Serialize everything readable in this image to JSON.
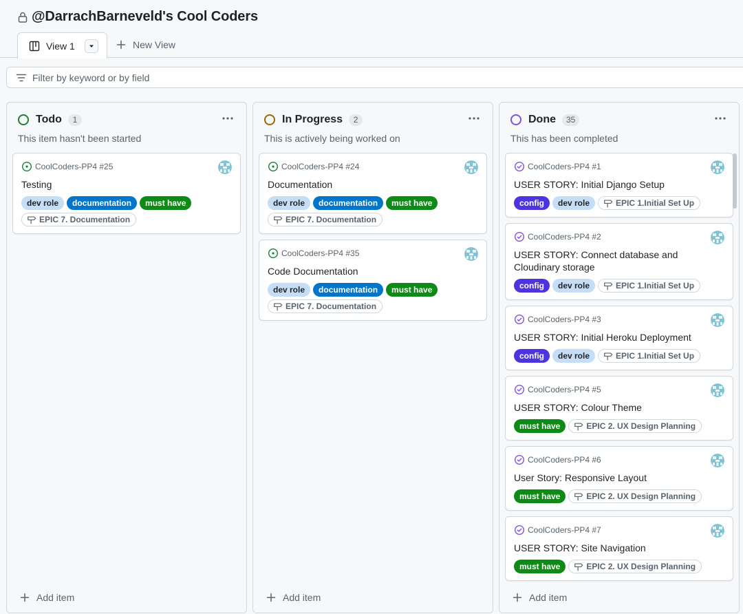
{
  "header": {
    "title": "@DarrachBarneveld's Cool Coders",
    "lock_icon": "lock-icon"
  },
  "tabs": {
    "active_label": "View 1",
    "new_view_label": "New View"
  },
  "filter": {
    "placeholder": "Filter by keyword or by field"
  },
  "colors": {
    "todo": "#1a7f37",
    "in_progress": "#9a6700",
    "done": "#8250df",
    "dev_role_bg": "#c5def5",
    "documentation_bg": "#0075ca",
    "must_have_bg": "#0e8a16",
    "config_bg": "#4c34e0"
  },
  "columns": [
    {
      "name": "Todo",
      "count": "1",
      "description": "This item hasn't been started",
      "add_label": "Add item",
      "cards": [
        {
          "repo": "CoolCoders-PP4 #25",
          "title": "Testing",
          "state": "open",
          "labels": [
            {
              "text": "dev role",
              "kind": "dev"
            },
            {
              "text": "documentation",
              "kind": "doc"
            },
            {
              "text": "must have",
              "kind": "must"
            }
          ],
          "milestone": "EPIC 7. Documentation"
        }
      ]
    },
    {
      "name": "In Progress",
      "count": "2",
      "description": "This is actively being worked on",
      "add_label": "Add item",
      "cards": [
        {
          "repo": "CoolCoders-PP4 #24",
          "title": "Documentation",
          "state": "open",
          "labels": [
            {
              "text": "dev role",
              "kind": "dev"
            },
            {
              "text": "documentation",
              "kind": "doc"
            },
            {
              "text": "must have",
              "kind": "must"
            }
          ],
          "milestone": "EPIC 7. Documentation"
        },
        {
          "repo": "CoolCoders-PP4 #35",
          "title": "Code Documentation",
          "state": "open",
          "labels": [
            {
              "text": "dev role",
              "kind": "dev"
            },
            {
              "text": "documentation",
              "kind": "doc"
            },
            {
              "text": "must have",
              "kind": "must"
            }
          ],
          "milestone": "EPIC 7. Documentation"
        }
      ]
    },
    {
      "name": "Done",
      "count": "35",
      "description": "This has been completed",
      "add_label": "Add item",
      "cards": [
        {
          "repo": "CoolCoders-PP4 #1",
          "title": "USER STORY: Initial Django Setup",
          "state": "closed",
          "labels": [
            {
              "text": "config",
              "kind": "config"
            },
            {
              "text": "dev role",
              "kind": "dev"
            }
          ],
          "milestone": "EPIC 1.Initial Set Up"
        },
        {
          "repo": "CoolCoders-PP4 #2",
          "title": "USER STORY: Connect database and Cloudinary storage",
          "state": "closed",
          "labels": [
            {
              "text": "config",
              "kind": "config"
            },
            {
              "text": "dev role",
              "kind": "dev"
            }
          ],
          "milestone": "EPIC 1.Initial Set Up"
        },
        {
          "repo": "CoolCoders-PP4 #3",
          "title": "USER STORY: Initial Heroku Deployment",
          "state": "closed",
          "labels": [
            {
              "text": "config",
              "kind": "config"
            },
            {
              "text": "dev role",
              "kind": "dev"
            }
          ],
          "milestone": "EPIC 1.Initial Set Up"
        },
        {
          "repo": "CoolCoders-PP4 #5",
          "title": "USER STORY: Colour Theme",
          "state": "closed",
          "labels": [
            {
              "text": "must have",
              "kind": "must"
            }
          ],
          "milestone": "EPIC 2. UX Design Planning"
        },
        {
          "repo": "CoolCoders-PP4 #6",
          "title": "User Story: Responsive Layout",
          "state": "closed",
          "labels": [
            {
              "text": "must have",
              "kind": "must"
            }
          ],
          "milestone": "EPIC 2. UX Design Planning"
        },
        {
          "repo": "CoolCoders-PP4 #7",
          "title": "USER STORY: Site Navigation",
          "state": "closed",
          "labels": [
            {
              "text": "must have",
              "kind": "must"
            }
          ],
          "milestone": "EPIC 2. UX Design Planning"
        }
      ]
    }
  ]
}
